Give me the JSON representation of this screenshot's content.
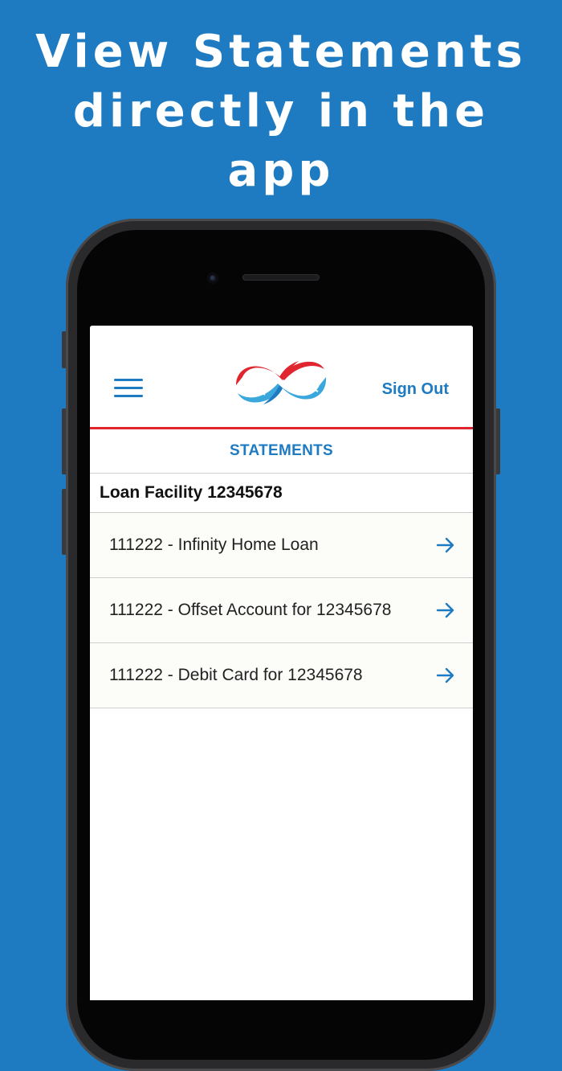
{
  "promo": {
    "headline_line1": "View Statements",
    "headline_line2": "directly in the",
    "headline_line3": "app"
  },
  "header": {
    "menu_icon": "hamburger-menu-icon",
    "logo_icon": "infinity-logo-icon",
    "sign_out_label": "Sign Out"
  },
  "page": {
    "title": "STATEMENTS"
  },
  "facility": {
    "label": "Loan Facility 12345678"
  },
  "accounts": [
    {
      "label": "111222 - Infinity Home Loan",
      "icon": "arrow-right-icon"
    },
    {
      "label": "111222 - Offset Account for 12345678",
      "icon": "arrow-right-icon"
    },
    {
      "label": "111222 - Debit Card for 12345678",
      "icon": "arrow-right-icon"
    }
  ],
  "colors": {
    "background": "#1e7bc2",
    "accent_blue": "#1e7bc2",
    "accent_red": "#e0252f",
    "light_blue": "#3aa7dd"
  }
}
